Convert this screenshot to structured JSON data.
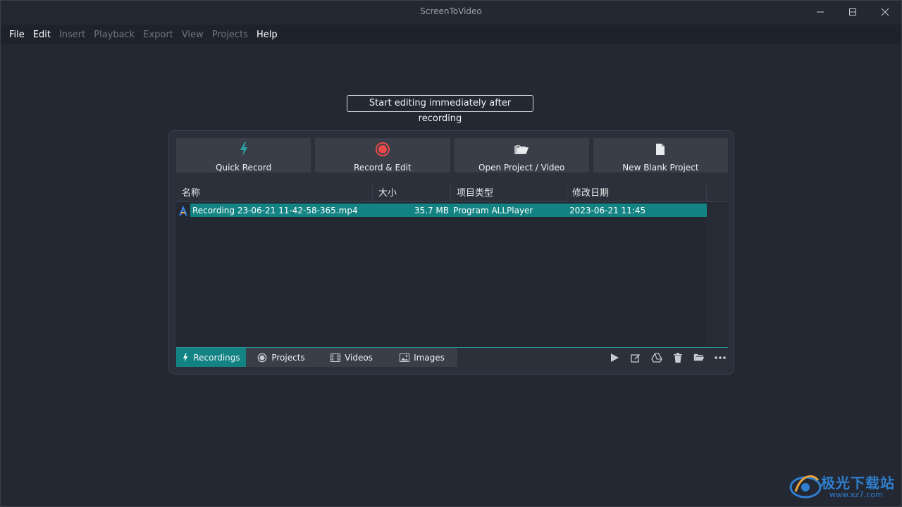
{
  "window": {
    "title": "ScreenToVideo",
    "minimize_icon": "minimize-icon",
    "maximize_icon": "maximize-icon",
    "close_icon": "close-icon"
  },
  "menu": [
    {
      "label": "File",
      "enabled": true
    },
    {
      "label": "Edit",
      "enabled": true
    },
    {
      "label": "Insert",
      "enabled": false
    },
    {
      "label": "Playback",
      "enabled": false
    },
    {
      "label": "Export",
      "enabled": false
    },
    {
      "label": "View",
      "enabled": false
    },
    {
      "label": "Projects",
      "enabled": false
    },
    {
      "label": "Help",
      "enabled": true
    }
  ],
  "start_edit_button": "Start editing immediately after recording",
  "actions": [
    {
      "label": "Quick Record",
      "icon": "lightning-icon",
      "color": "#2aa3a3"
    },
    {
      "label": "Record & Edit",
      "icon": "record-icon",
      "color": "#e84a4a"
    },
    {
      "label": "Open Project / Video",
      "icon": "folder-open-icon",
      "color": "#e8eaed"
    },
    {
      "label": "New Blank Project",
      "icon": "document-icon",
      "color": "#e8eaed"
    }
  ],
  "table": {
    "columns": [
      "名称",
      "大小",
      "项目类型",
      "修改日期"
    ],
    "rows": [
      {
        "name": "Recording 23-06-21 11-42-58-365.mp4",
        "size": "35.7 MB",
        "type": "Program ALLPlayer",
        "modified": "2023-06-21 11:45",
        "selected": true
      }
    ]
  },
  "tabs": [
    {
      "label": "Recordings",
      "icon": "lightning-icon",
      "active": true
    },
    {
      "label": "Projects",
      "icon": "record-icon",
      "active": false
    },
    {
      "label": "Videos",
      "icon": "film-icon",
      "active": false
    },
    {
      "label": "Images",
      "icon": "image-icon",
      "active": false
    }
  ],
  "toolbar_icons": [
    "play-icon",
    "edit-icon",
    "drive-upload-icon",
    "trash-icon",
    "folder-icon",
    "more-icon"
  ],
  "watermark": {
    "text": "极光下载站",
    "url": "www.xz7.com"
  },
  "colors": {
    "accent": "#128282",
    "background": "#232833",
    "panel": "#2b303a",
    "button": "#393e49"
  }
}
